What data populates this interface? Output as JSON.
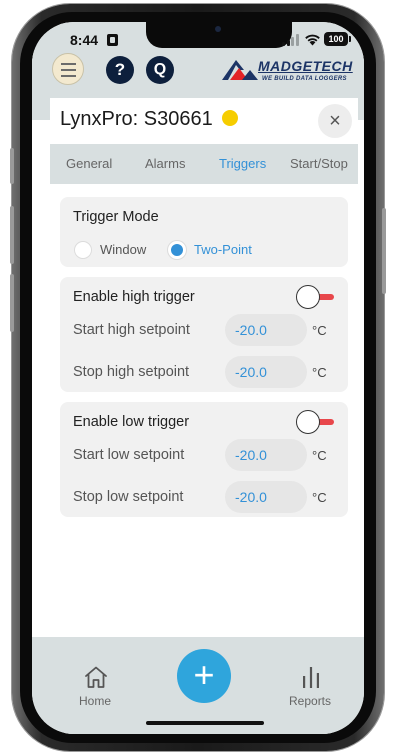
{
  "status_bar": {
    "time": "8:44",
    "battery": "100",
    "signal_icon": "cellular-signal-icon",
    "wifi_icon": "wifi-icon"
  },
  "header": {
    "menu_icon": "hamburger-menu-icon",
    "help_label": "?",
    "q_label": "Q",
    "logo_name": "MADGETECH",
    "logo_tagline": "WE BUILD DATA LOGGERS"
  },
  "device": {
    "title": "LynxPro: S30661",
    "status_color": "#f6cd00",
    "close_label": "×"
  },
  "tabs": [
    {
      "label": "General",
      "active": false
    },
    {
      "label": "Alarms",
      "active": false
    },
    {
      "label": "Triggers",
      "active": true
    },
    {
      "label": "Start/Stop",
      "active": false
    }
  ],
  "trigger_mode": {
    "label": "Trigger Mode",
    "options": [
      {
        "label": "Window",
        "selected": false
      },
      {
        "label": "Two-Point",
        "selected": true
      }
    ]
  },
  "high_trigger": {
    "enable_label": "Enable high trigger",
    "enabled": false,
    "start_label": "Start high setpoint",
    "start_value": "-20.0",
    "stop_label": "Stop high setpoint",
    "stop_value": "-20.0",
    "unit": "°C"
  },
  "low_trigger": {
    "enable_label": "Enable low trigger",
    "enabled": false,
    "start_label": "Start low setpoint",
    "start_value": "-20.0",
    "stop_label": "Stop low setpoint",
    "stop_value": "-20.0",
    "unit": "°C"
  },
  "bottom_nav": {
    "home_label": "Home",
    "add_label": "+",
    "reports_label": "Reports"
  },
  "colors": {
    "accent": "#3391d7",
    "fab": "#2fa5dc",
    "toggle_off_track": "#e8474b",
    "bar_background": "#d8dfe0"
  }
}
